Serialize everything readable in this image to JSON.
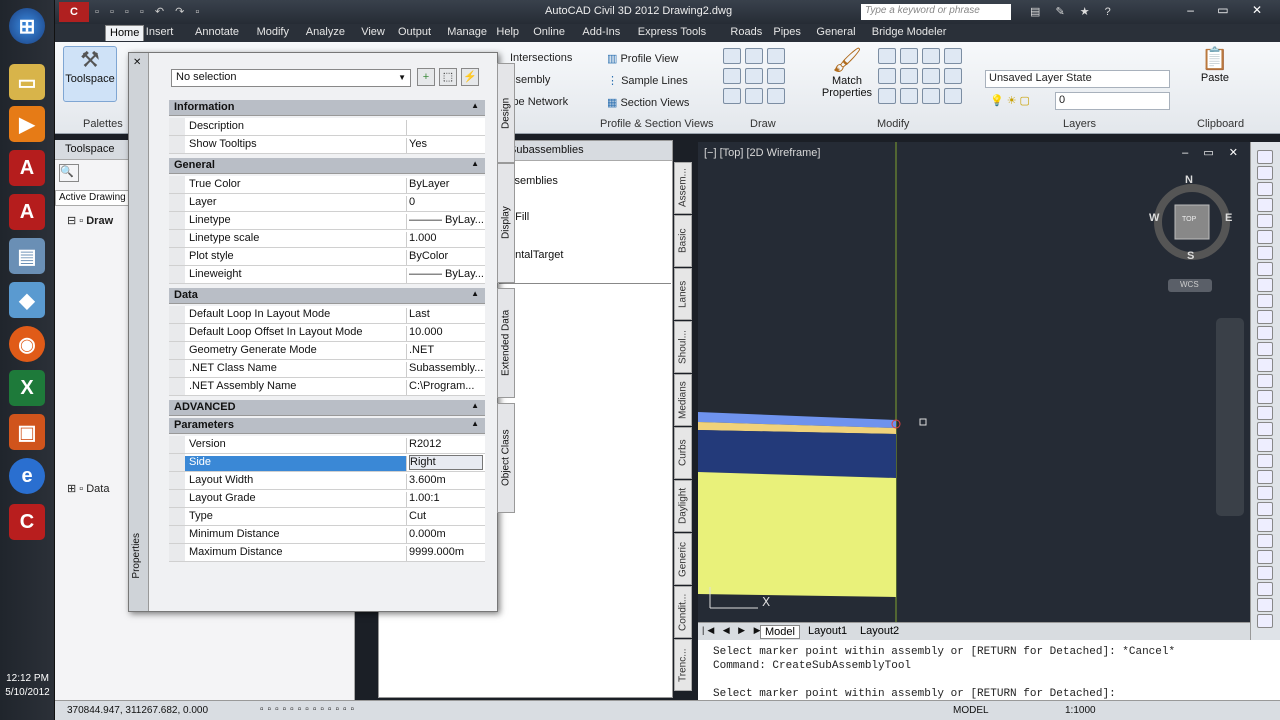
{
  "app": {
    "title": "AutoCAD Civil 3D 2012   Drawing2.dwg",
    "search_placeholder": "Type a keyword or phrase"
  },
  "ribbon_tabs": [
    "Home",
    "Insert",
    "Annotate",
    "Modify",
    "Analyze",
    "View",
    "Output",
    "Manage",
    "Help",
    "Online",
    "Add-Ins",
    "Express Tools",
    "Roads",
    "Pipes",
    "General",
    "Bridge Modeler"
  ],
  "ribbon": {
    "toolspace_label": "Toolspace",
    "palettes_label": "Palettes",
    "intersections": "Intersections",
    "assembly": "ssembly",
    "pipe_network": "ipe Network",
    "profile_view": "Profile View",
    "sample_lines": "Sample Lines",
    "section_views": "Section Views",
    "profile_section_label": "Profile & Section Views",
    "draw_label": "Draw",
    "match_properties": "Match Properties",
    "modify_label": "Modify",
    "layer_state": "Unsaved Layer State",
    "layer_current": "0",
    "layers_label": "Layers",
    "paste": "Paste",
    "clipboard_label": "Clipboard"
  },
  "toolspace": {
    "header": "Toolspace",
    "active_tab": "Active Drawing",
    "root": "Draw",
    "data": "Data"
  },
  "tool_palette": {
    "header": "Subassemblies",
    "items": [
      "ssemblies",
      "eFill",
      "ontalTarget"
    ],
    "tabs": [
      "Assem...",
      "Basic",
      "Lanes",
      "Shoul...",
      "Medians",
      "Curbs",
      "Daylight",
      "Generic",
      "Condit...",
      "Trenc..."
    ]
  },
  "properties": {
    "selection": "No selection",
    "side_label": "Properties",
    "tabs": [
      "Design",
      "Display",
      "Extended Data",
      "Object Class"
    ],
    "sections": {
      "information": "Information",
      "general": "General",
      "data": "Data",
      "advanced": "ADVANCED",
      "parameters": "Parameters"
    },
    "information": [
      {
        "k": "Description",
        "v": ""
      },
      {
        "k": "Show Tooltips",
        "v": "Yes"
      }
    ],
    "general": [
      {
        "k": "True Color",
        "v": "ByLayer"
      },
      {
        "k": "Layer",
        "v": "0"
      },
      {
        "k": "Linetype",
        "v": "——— ByLay..."
      },
      {
        "k": "Linetype scale",
        "v": "1.000"
      },
      {
        "k": "Plot style",
        "v": "ByColor"
      },
      {
        "k": "Lineweight",
        "v": "——— ByLay..."
      }
    ],
    "data": [
      {
        "k": "Default Loop In Layout Mode",
        "v": "Last"
      },
      {
        "k": "Default Loop Offset In Layout Mode",
        "v": "10.000"
      },
      {
        "k": "Geometry Generate Mode",
        "v": ".NET"
      },
      {
        "k": ".NET Class Name",
        "v": "Subassembly..."
      },
      {
        "k": ".NET Assembly Name",
        "v": "C:\\Program..."
      }
    ],
    "parameters": [
      {
        "k": "Version",
        "v": "R2012"
      },
      {
        "k": "Side",
        "v": "Right"
      },
      {
        "k": "Layout Width",
        "v": "3.600m"
      },
      {
        "k": "Layout Grade",
        "v": "1.00:1"
      },
      {
        "k": "Type",
        "v": "Cut"
      },
      {
        "k": "Minimum Distance",
        "v": "0.000m"
      },
      {
        "k": "Maximum Distance",
        "v": "9999.000m"
      }
    ]
  },
  "viewport": {
    "label": "[−] [Top] [2D Wireframe]",
    "compass": {
      "n": "N",
      "s": "S",
      "e": "E",
      "w": "W",
      "top": "TOP"
    },
    "wcs": "WCS"
  },
  "layout_tabs": [
    "Model",
    "Layout1",
    "Layout2"
  ],
  "command_lines": [
    "Select marker point within assembly or [RETURN for Detached]: *Cancel*",
    "Command: CreateSubAssemblyTool",
    "",
    "Select marker point within assembly or [RETURN for Detached]:"
  ],
  "status": {
    "coords": "370844.947, 311267.682, 0.000",
    "model": "MODEL",
    "scale": "1:1000"
  },
  "clock": {
    "time": "12:12 PM",
    "date": "5/10/2012"
  }
}
